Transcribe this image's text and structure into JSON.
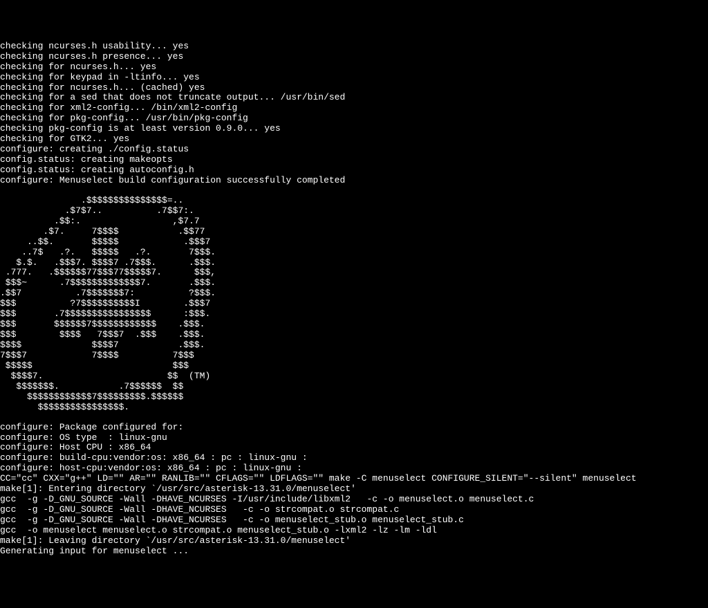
{
  "lines": [
    "checking ncurses.h usability... yes",
    "checking ncurses.h presence... yes",
    "checking for ncurses.h... yes",
    "checking for keypad in -ltinfo... yes",
    "checking for ncurses.h... (cached) yes",
    "checking for a sed that does not truncate output... /usr/bin/sed",
    "checking for xml2-config... /bin/xml2-config",
    "checking for pkg-config... /usr/bin/pkg-config",
    "checking pkg-config is at least version 0.9.0... yes",
    "checking for GTK2... yes",
    "configure: creating ./config.status",
    "config.status: creating makeopts",
    "config.status: creating autoconfig.h",
    "configure: Menuselect build configuration successfully completed",
    "",
    "               .$$$$$$$$$$$$$$$=..",
    "            .$7$7..          .7$$7:.",
    "          .$$:.                 ,$7.7",
    "        .$7.     7$$$$           .$$77",
    "     ..$$.       $$$$$            .$$$7",
    "    ..7$   .?.   $$$$$   .?.       7$$$.",
    "   $.$.   .$$$7. $$$$7 .7$$$.      .$$$.",
    " .777.   .$$$$$$77$$$77$$$$$7.      $$$,",
    " $$$~      .7$$$$$$$$$$$$$7.       .$$$.",
    ".$$7          .7$$$$$$$7:          ?$$$.",
    "$$$          ?7$$$$$$$$$$I        .$$$7",
    "$$$       .7$$$$$$$$$$$$$$$$      :$$$.",
    "$$$       $$$$$$7$$$$$$$$$$$$    .$$$.",
    "$$$        $$$$   7$$$7  .$$$    .$$$.",
    "$$$$             $$$$7           .$$$.",
    "7$$$7            7$$$$          7$$$",
    " $$$$$                          $$$",
    "  $$$$7.                       $$  (TM)",
    "   $$$$$$$.           .7$$$$$$  $$",
    "     $$$$$$$$$$$$7$$$$$$$$$.$$$$$$",
    "       $$$$$$$$$$$$$$$$.",
    "",
    "configure: Package configured for:",
    "configure: OS type  : linux-gnu",
    "configure: Host CPU : x86_64",
    "configure: build-cpu:vendor:os: x86_64 : pc : linux-gnu :",
    "configure: host-cpu:vendor:os: x86_64 : pc : linux-gnu :",
    "CC=\"cc\" CXX=\"g++\" LD=\"\" AR=\"\" RANLIB=\"\" CFLAGS=\"\" LDFLAGS=\"\" make -C menuselect CONFIGURE_SILENT=\"--silent\" menuselect",
    "make[1]: Entering directory `/usr/src/asterisk-13.31.0/menuselect'",
    "gcc  -g -D_GNU_SOURCE -Wall -DHAVE_NCURSES -I/usr/include/libxml2   -c -o menuselect.o menuselect.c",
    "gcc  -g -D_GNU_SOURCE -Wall -DHAVE_NCURSES   -c -o strcompat.o strcompat.c",
    "gcc  -g -D_GNU_SOURCE -Wall -DHAVE_NCURSES   -c -o menuselect_stub.o menuselect_stub.c",
    "gcc  -o menuselect menuselect.o strcompat.o menuselect_stub.o -lxml2 -lz -lm -ldl",
    "make[1]: Leaving directory `/usr/src/asterisk-13.31.0/menuselect'",
    "Generating input for menuselect ..."
  ]
}
